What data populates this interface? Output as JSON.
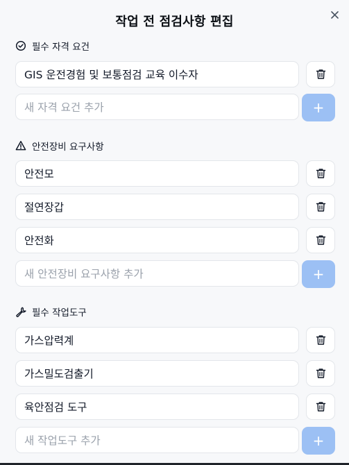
{
  "dialog": {
    "title": "작업 전 점검사항 편집",
    "close_icon": "close-icon"
  },
  "sections": [
    {
      "icon": "check-circle-icon",
      "title": "필수 자격 요건",
      "items": [
        "GIS 운전경험 및 보통점검 교육 이수자"
      ],
      "add_placeholder": "새 자격 요건 추가",
      "add_label": "+"
    },
    {
      "icon": "warning-triangle-icon",
      "title": "안전장비 요구사항",
      "items": [
        "안전모",
        "절연장갑",
        "안전화"
      ],
      "add_placeholder": "새 안전장비 요구사항 추가",
      "add_label": "+"
    },
    {
      "icon": "wrench-icon",
      "title": "필수 작업도구",
      "items": [
        "가스압력계",
        "가스밀도검출기",
        "육안점검 도구"
      ],
      "add_placeholder": "새 작업도구 추가",
      "add_label": "+"
    }
  ],
  "colors": {
    "background": "#f7f8fa",
    "add_button": "#9cc0f4",
    "placeholder": "#9aa1ab",
    "border": "#e3e6ea"
  }
}
